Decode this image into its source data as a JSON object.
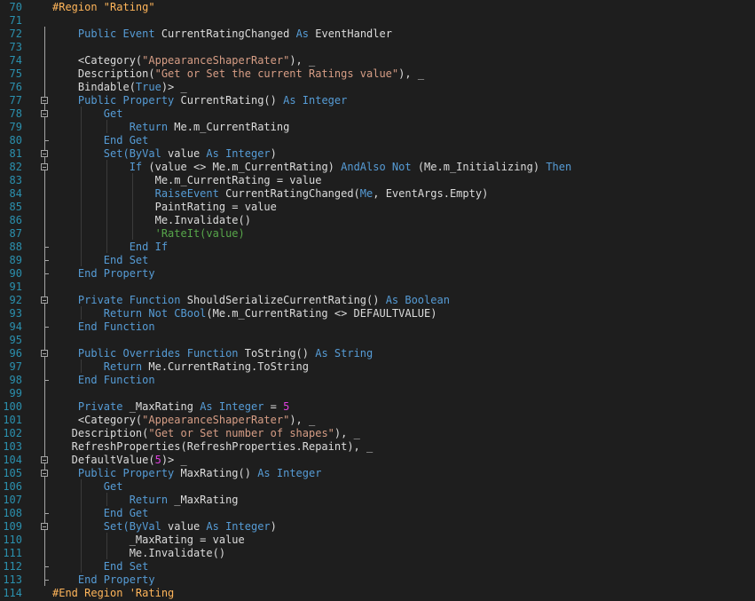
{
  "editor": {
    "lines": [
      {
        "num": "70",
        "tokens": [
          {
            "t": "#Region ",
            "c": "region"
          },
          {
            "t": "\"Rating\"",
            "c": "region"
          }
        ]
      },
      {
        "num": "71",
        "tokens": []
      },
      {
        "num": "72",
        "tokens": [
          {
            "t": "    ",
            "c": "default"
          },
          {
            "t": "Public Event",
            "c": "keyword"
          },
          {
            "t": " CurrentRatingChanged ",
            "c": "default"
          },
          {
            "t": "As",
            "c": "keyword"
          },
          {
            "t": " EventHandler",
            "c": "default"
          }
        ]
      },
      {
        "num": "73",
        "tokens": []
      },
      {
        "num": "74",
        "tokens": [
          {
            "t": "    <Category(",
            "c": "default"
          },
          {
            "t": "\"AppearanceShaperRater\"",
            "c": "string"
          },
          {
            "t": "), _",
            "c": "default"
          }
        ]
      },
      {
        "num": "75",
        "tokens": [
          {
            "t": "    Description(",
            "c": "default"
          },
          {
            "t": "\"Get or Set the current Ratings value\"",
            "c": "string"
          },
          {
            "t": "), _",
            "c": "default"
          }
        ]
      },
      {
        "num": "76",
        "tokens": [
          {
            "t": "    Bindable(",
            "c": "default"
          },
          {
            "t": "True",
            "c": "keyword"
          },
          {
            "t": ")> _",
            "c": "default"
          }
        ]
      },
      {
        "num": "77",
        "tokens": [
          {
            "t": "    ",
            "c": "default"
          },
          {
            "t": "Public Property",
            "c": "keyword"
          },
          {
            "t": " CurrentRating() ",
            "c": "default"
          },
          {
            "t": "As Integer",
            "c": "keyword"
          }
        ]
      },
      {
        "num": "78",
        "tokens": [
          {
            "t": "        ",
            "c": "default"
          },
          {
            "t": "Get",
            "c": "keyword"
          }
        ]
      },
      {
        "num": "79",
        "tokens": [
          {
            "t": "            ",
            "c": "default"
          },
          {
            "t": "Return",
            "c": "keyword"
          },
          {
            "t": " Me.m_CurrentRating",
            "c": "default"
          }
        ]
      },
      {
        "num": "80",
        "tokens": [
          {
            "t": "        ",
            "c": "default"
          },
          {
            "t": "End Get",
            "c": "keyword"
          }
        ]
      },
      {
        "num": "81",
        "tokens": [
          {
            "t": "        ",
            "c": "default"
          },
          {
            "t": "Set(ByVal",
            "c": "keyword"
          },
          {
            "t": " value ",
            "c": "default"
          },
          {
            "t": "As Integer",
            "c": "keyword"
          },
          {
            "t": ")",
            "c": "default"
          }
        ]
      },
      {
        "num": "82",
        "tokens": [
          {
            "t": "            ",
            "c": "default"
          },
          {
            "t": "If",
            "c": "keyword"
          },
          {
            "t": " (value <> Me.m_CurrentRating) ",
            "c": "default"
          },
          {
            "t": "AndAlso Not",
            "c": "keyword"
          },
          {
            "t": " (Me.m_Initializing) ",
            "c": "default"
          },
          {
            "t": "Then",
            "c": "keyword"
          }
        ]
      },
      {
        "num": "83",
        "tokens": [
          {
            "t": "                Me.m_CurrentRating = value",
            "c": "default"
          }
        ]
      },
      {
        "num": "84",
        "tokens": [
          {
            "t": "                ",
            "c": "default"
          },
          {
            "t": "RaiseEvent",
            "c": "keyword"
          },
          {
            "t": " CurrentRatingChanged(",
            "c": "default"
          },
          {
            "t": "Me",
            "c": "keyword"
          },
          {
            "t": ", EventArgs.Empty)",
            "c": "default"
          }
        ]
      },
      {
        "num": "85",
        "tokens": [
          {
            "t": "                PaintRating = value",
            "c": "default"
          }
        ]
      },
      {
        "num": "86",
        "tokens": [
          {
            "t": "                Me.Invalidate()",
            "c": "default"
          }
        ]
      },
      {
        "num": "87",
        "tokens": [
          {
            "t": "                ",
            "c": "default"
          },
          {
            "t": "'RateIt(value)",
            "c": "comment"
          }
        ]
      },
      {
        "num": "88",
        "tokens": [
          {
            "t": "            ",
            "c": "default"
          },
          {
            "t": "End If",
            "c": "keyword"
          }
        ]
      },
      {
        "num": "89",
        "tokens": [
          {
            "t": "        ",
            "c": "default"
          },
          {
            "t": "End Set",
            "c": "keyword"
          }
        ]
      },
      {
        "num": "90",
        "tokens": [
          {
            "t": "    ",
            "c": "default"
          },
          {
            "t": "End Property",
            "c": "keyword"
          }
        ]
      },
      {
        "num": "91",
        "tokens": []
      },
      {
        "num": "92",
        "tokens": [
          {
            "t": "    ",
            "c": "default"
          },
          {
            "t": "Private Function",
            "c": "keyword"
          },
          {
            "t": " ShouldSerializeCurrentRating() ",
            "c": "default"
          },
          {
            "t": "As Boolean",
            "c": "keyword"
          }
        ]
      },
      {
        "num": "93",
        "tokens": [
          {
            "t": "        ",
            "c": "default"
          },
          {
            "t": "Return Not CBool",
            "c": "keyword"
          },
          {
            "t": "(Me.m_CurrentRating <> DEFAULTVALUE)",
            "c": "default"
          }
        ]
      },
      {
        "num": "94",
        "tokens": [
          {
            "t": "    ",
            "c": "default"
          },
          {
            "t": "End Function",
            "c": "keyword"
          }
        ]
      },
      {
        "num": "95",
        "tokens": []
      },
      {
        "num": "96",
        "tokens": [
          {
            "t": "    ",
            "c": "default"
          },
          {
            "t": "Public Overrides Function",
            "c": "keyword"
          },
          {
            "t": " ToString() ",
            "c": "default"
          },
          {
            "t": "As String",
            "c": "keyword"
          }
        ]
      },
      {
        "num": "97",
        "tokens": [
          {
            "t": "        ",
            "c": "default"
          },
          {
            "t": "Return",
            "c": "keyword"
          },
          {
            "t": " Me.CurrentRating.ToString",
            "c": "default"
          }
        ]
      },
      {
        "num": "98",
        "tokens": [
          {
            "t": "    ",
            "c": "default"
          },
          {
            "t": "End Function",
            "c": "keyword"
          }
        ]
      },
      {
        "num": "99",
        "tokens": []
      },
      {
        "num": "100",
        "tokens": [
          {
            "t": "    ",
            "c": "default"
          },
          {
            "t": "Private",
            "c": "keyword"
          },
          {
            "t": " _MaxRating ",
            "c": "default"
          },
          {
            "t": "As Integer",
            "c": "keyword"
          },
          {
            "t": " = ",
            "c": "default"
          },
          {
            "t": "5",
            "c": "magenta"
          }
        ]
      },
      {
        "num": "101",
        "tokens": [
          {
            "t": "    <Category(",
            "c": "default"
          },
          {
            "t": "\"AppearanceShaperRater\"",
            "c": "string"
          },
          {
            "t": "), _",
            "c": "default"
          }
        ]
      },
      {
        "num": "102",
        "tokens": [
          {
            "t": "   Description(",
            "c": "default"
          },
          {
            "t": "\"Get or Set number of shapes\"",
            "c": "string"
          },
          {
            "t": "), _",
            "c": "default"
          }
        ]
      },
      {
        "num": "103",
        "tokens": [
          {
            "t": "   RefreshProperties(RefreshProperties.Repaint), _",
            "c": "default"
          }
        ]
      },
      {
        "num": "104",
        "tokens": [
          {
            "t": "   DefaultValue(",
            "c": "default"
          },
          {
            "t": "5",
            "c": "magenta"
          },
          {
            "t": ")> _",
            "c": "default"
          }
        ]
      },
      {
        "num": "105",
        "tokens": [
          {
            "t": "    ",
            "c": "default"
          },
          {
            "t": "Public Property",
            "c": "keyword"
          },
          {
            "t": " MaxRating() ",
            "c": "default"
          },
          {
            "t": "As Integer",
            "c": "keyword"
          }
        ]
      },
      {
        "num": "106",
        "tokens": [
          {
            "t": "        ",
            "c": "default"
          },
          {
            "t": "Get",
            "c": "keyword"
          }
        ]
      },
      {
        "num": "107",
        "tokens": [
          {
            "t": "            ",
            "c": "default"
          },
          {
            "t": "Return",
            "c": "keyword"
          },
          {
            "t": " _MaxRating",
            "c": "default"
          }
        ]
      },
      {
        "num": "108",
        "tokens": [
          {
            "t": "        ",
            "c": "default"
          },
          {
            "t": "End Get",
            "c": "keyword"
          }
        ]
      },
      {
        "num": "109",
        "tokens": [
          {
            "t": "        ",
            "c": "default"
          },
          {
            "t": "Set(ByVal",
            "c": "keyword"
          },
          {
            "t": " value ",
            "c": "default"
          },
          {
            "t": "As Integer",
            "c": "keyword"
          },
          {
            "t": ")",
            "c": "default"
          }
        ]
      },
      {
        "num": "110",
        "tokens": [
          {
            "t": "            _MaxRating = value",
            "c": "default"
          }
        ]
      },
      {
        "num": "111",
        "tokens": [
          {
            "t": "            Me.Invalidate()",
            "c": "default"
          }
        ]
      },
      {
        "num": "112",
        "tokens": [
          {
            "t": "        ",
            "c": "default"
          },
          {
            "t": "End Set",
            "c": "keyword"
          }
        ]
      },
      {
        "num": "113",
        "tokens": [
          {
            "t": "    ",
            "c": "default"
          },
          {
            "t": "End Property",
            "c": "keyword"
          }
        ]
      },
      {
        "num": "114",
        "tokens": [
          {
            "t": "#End Region 'Rating",
            "c": "region"
          }
        ]
      }
    ],
    "fold_markers": [
      {
        "line": "77",
        "type": "open"
      },
      {
        "line": "78",
        "type": "open"
      },
      {
        "line": "81",
        "type": "open"
      },
      {
        "line": "82",
        "type": "open"
      },
      {
        "line": "92",
        "type": "open"
      },
      {
        "line": "96",
        "type": "open"
      },
      {
        "line": "104",
        "type": "open"
      },
      {
        "line": "105",
        "type": "open"
      },
      {
        "line": "109",
        "type": "open"
      }
    ],
    "colors": {
      "background": "#1e1e1e",
      "line_number": "#2b91af",
      "keyword": "#569cd6",
      "string": "#d69d85",
      "comment": "#57a64a",
      "number": "#e040e0",
      "region": "#ffb55a",
      "default": "#dcdcdc"
    }
  }
}
